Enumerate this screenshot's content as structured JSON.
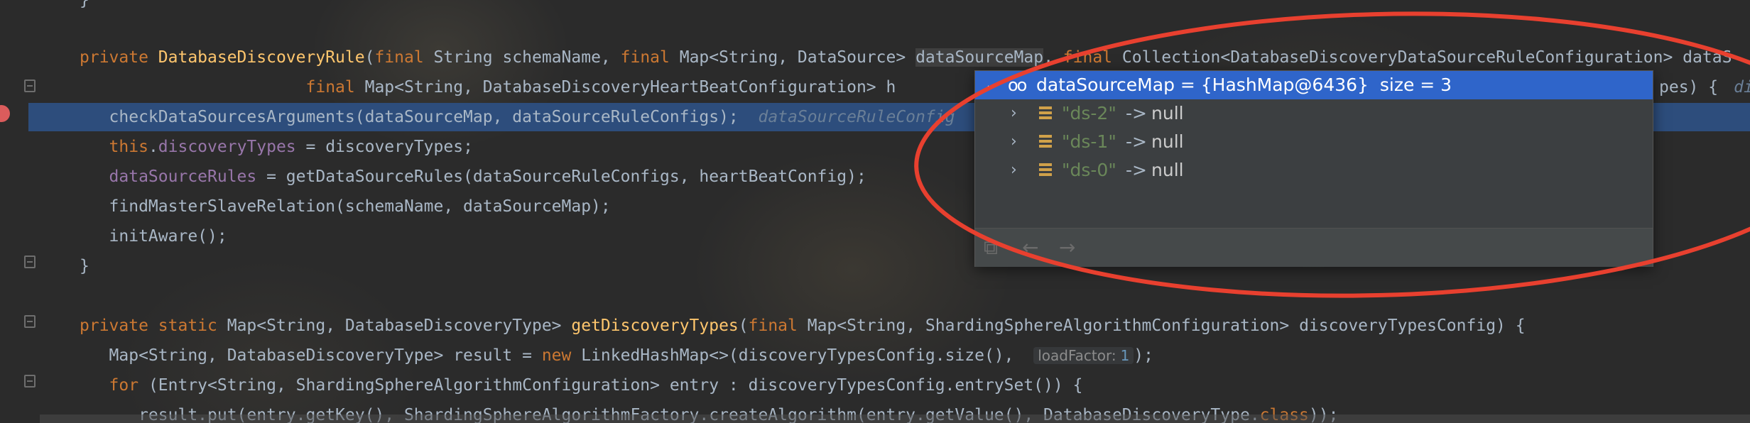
{
  "code_lines": [
    {
      "id": "line-0",
      "text": "}"
    },
    {
      "id": "line-1",
      "parts": [
        {
          "t": "private ",
          "c": "kw"
        },
        {
          "t": "DatabaseDiscoveryRule",
          "c": "fn"
        },
        {
          "t": "(",
          "c": ""
        },
        {
          "t": "final ",
          "c": "kw"
        },
        {
          "t": "String schemaName, ",
          "c": ""
        },
        {
          "t": "final ",
          "c": "kw"
        },
        {
          "t": "Map<String, DataSource> ",
          "c": ""
        },
        {
          "t": "dataSourceMap",
          "c": "hl"
        },
        {
          "t": ", ",
          "c": ""
        },
        {
          "t": "final ",
          "c": "kw"
        },
        {
          "t": "Collection<DatabaseDiscoveryDataSourceRuleConfiguration> dataS",
          "c": ""
        }
      ]
    },
    {
      "id": "line-2",
      "parts": [
        {
          "t": "                       ",
          "c": ""
        },
        {
          "t": "final ",
          "c": "kw"
        },
        {
          "t": "Map<String, DatabaseDiscoveryHeartBeatConfiguration> h",
          "c": ""
        }
      ],
      "tail": "pes) {",
      "tail_inlay": "di"
    },
    {
      "id": "line-3",
      "parts": [
        {
          "t": "   checkDataSourcesArguments(dataSourceMap, dataSourceRuleConfigs);  ",
          "c": ""
        },
        {
          "t": "dataSourceRuleConfig",
          "c": "inline-val"
        }
      ]
    },
    {
      "id": "line-4",
      "parts": [
        {
          "t": "   ",
          "c": ""
        },
        {
          "t": "this",
          "c": "kw"
        },
        {
          "t": ".",
          "c": ""
        },
        {
          "t": "discoveryTypes",
          "c": "fld"
        },
        {
          "t": " = discoveryTypes;",
          "c": ""
        }
      ]
    },
    {
      "id": "line-5",
      "parts": [
        {
          "t": "   ",
          "c": ""
        },
        {
          "t": "dataSourceRules",
          "c": "fld"
        },
        {
          "t": " = getDataSourceRules(dataSourceRuleConfigs, heartBeatConfig);",
          "c": ""
        }
      ]
    },
    {
      "id": "line-6",
      "parts": [
        {
          "t": "   findMasterSlaveRelation(schemaName, dataSourceMap);",
          "c": ""
        }
      ]
    },
    {
      "id": "line-7",
      "parts": [
        {
          "t": "   initAware();",
          "c": ""
        }
      ]
    },
    {
      "id": "line-8",
      "parts": [
        {
          "t": "}",
          "c": ""
        }
      ]
    },
    {
      "id": "line-9",
      "parts": []
    },
    {
      "id": "line-10",
      "parts": [
        {
          "t": "private static ",
          "c": "kw"
        },
        {
          "t": "Map<String, DatabaseDiscoveryType> ",
          "c": ""
        },
        {
          "t": "getDiscoveryTypes",
          "c": "fn"
        },
        {
          "t": "(",
          "c": ""
        },
        {
          "t": "final ",
          "c": "kw"
        },
        {
          "t": "Map<String, ShardingSphereAlgorithmConfiguration> discoveryTypesConfig) {",
          "c": ""
        }
      ]
    },
    {
      "id": "line-11",
      "parts": [
        {
          "t": "   Map<String, DatabaseDiscoveryType> result = ",
          "c": ""
        },
        {
          "t": "new ",
          "c": "kw"
        },
        {
          "t": "LinkedHashMap<>(discoveryTypesConfig.size(),  ",
          "c": ""
        }
      ],
      "inlay": {
        "label": "loadFactor:",
        "value": "1"
      },
      "after_inlay": ");"
    },
    {
      "id": "line-12",
      "parts": [
        {
          "t": "   ",
          "c": ""
        },
        {
          "t": "for ",
          "c": "kw"
        },
        {
          "t": "(Entry<String, ShardingSphereAlgorithmConfiguration> entry : discoveryTypesConfig.entrySet()) {",
          "c": ""
        }
      ]
    },
    {
      "id": "line-13",
      "parts": [
        {
          "t": "      result.put(entry.getKey(), ShardingSphereAlgorithmFactory.createAlgorithm(entry.getValue(), DatabaseDiscoveryType.",
          "c": ""
        },
        {
          "t": "class",
          "c": "kw"
        },
        {
          "t": "));",
          "c": ""
        }
      ]
    }
  ],
  "debug_popup": {
    "header": "dataSourceMap = {HashMap@6436}  size = 3",
    "entries": [
      {
        "key": "\"ds-2\"",
        "arrow": "->",
        "value": "null"
      },
      {
        "key": "\"ds-1\"",
        "arrow": "->",
        "value": "null"
      },
      {
        "key": "\"ds-0\"",
        "arrow": "->",
        "value": "null"
      }
    ],
    "toolbar": {
      "copy_icon": "copy-icon",
      "back_icon": "back-arrow-icon",
      "forward_icon": "forward-arrow-icon"
    }
  },
  "colors": {
    "annotation": "#e8402f",
    "header_selected": "#2f65ca",
    "execution_line": "#2d4d7c"
  }
}
